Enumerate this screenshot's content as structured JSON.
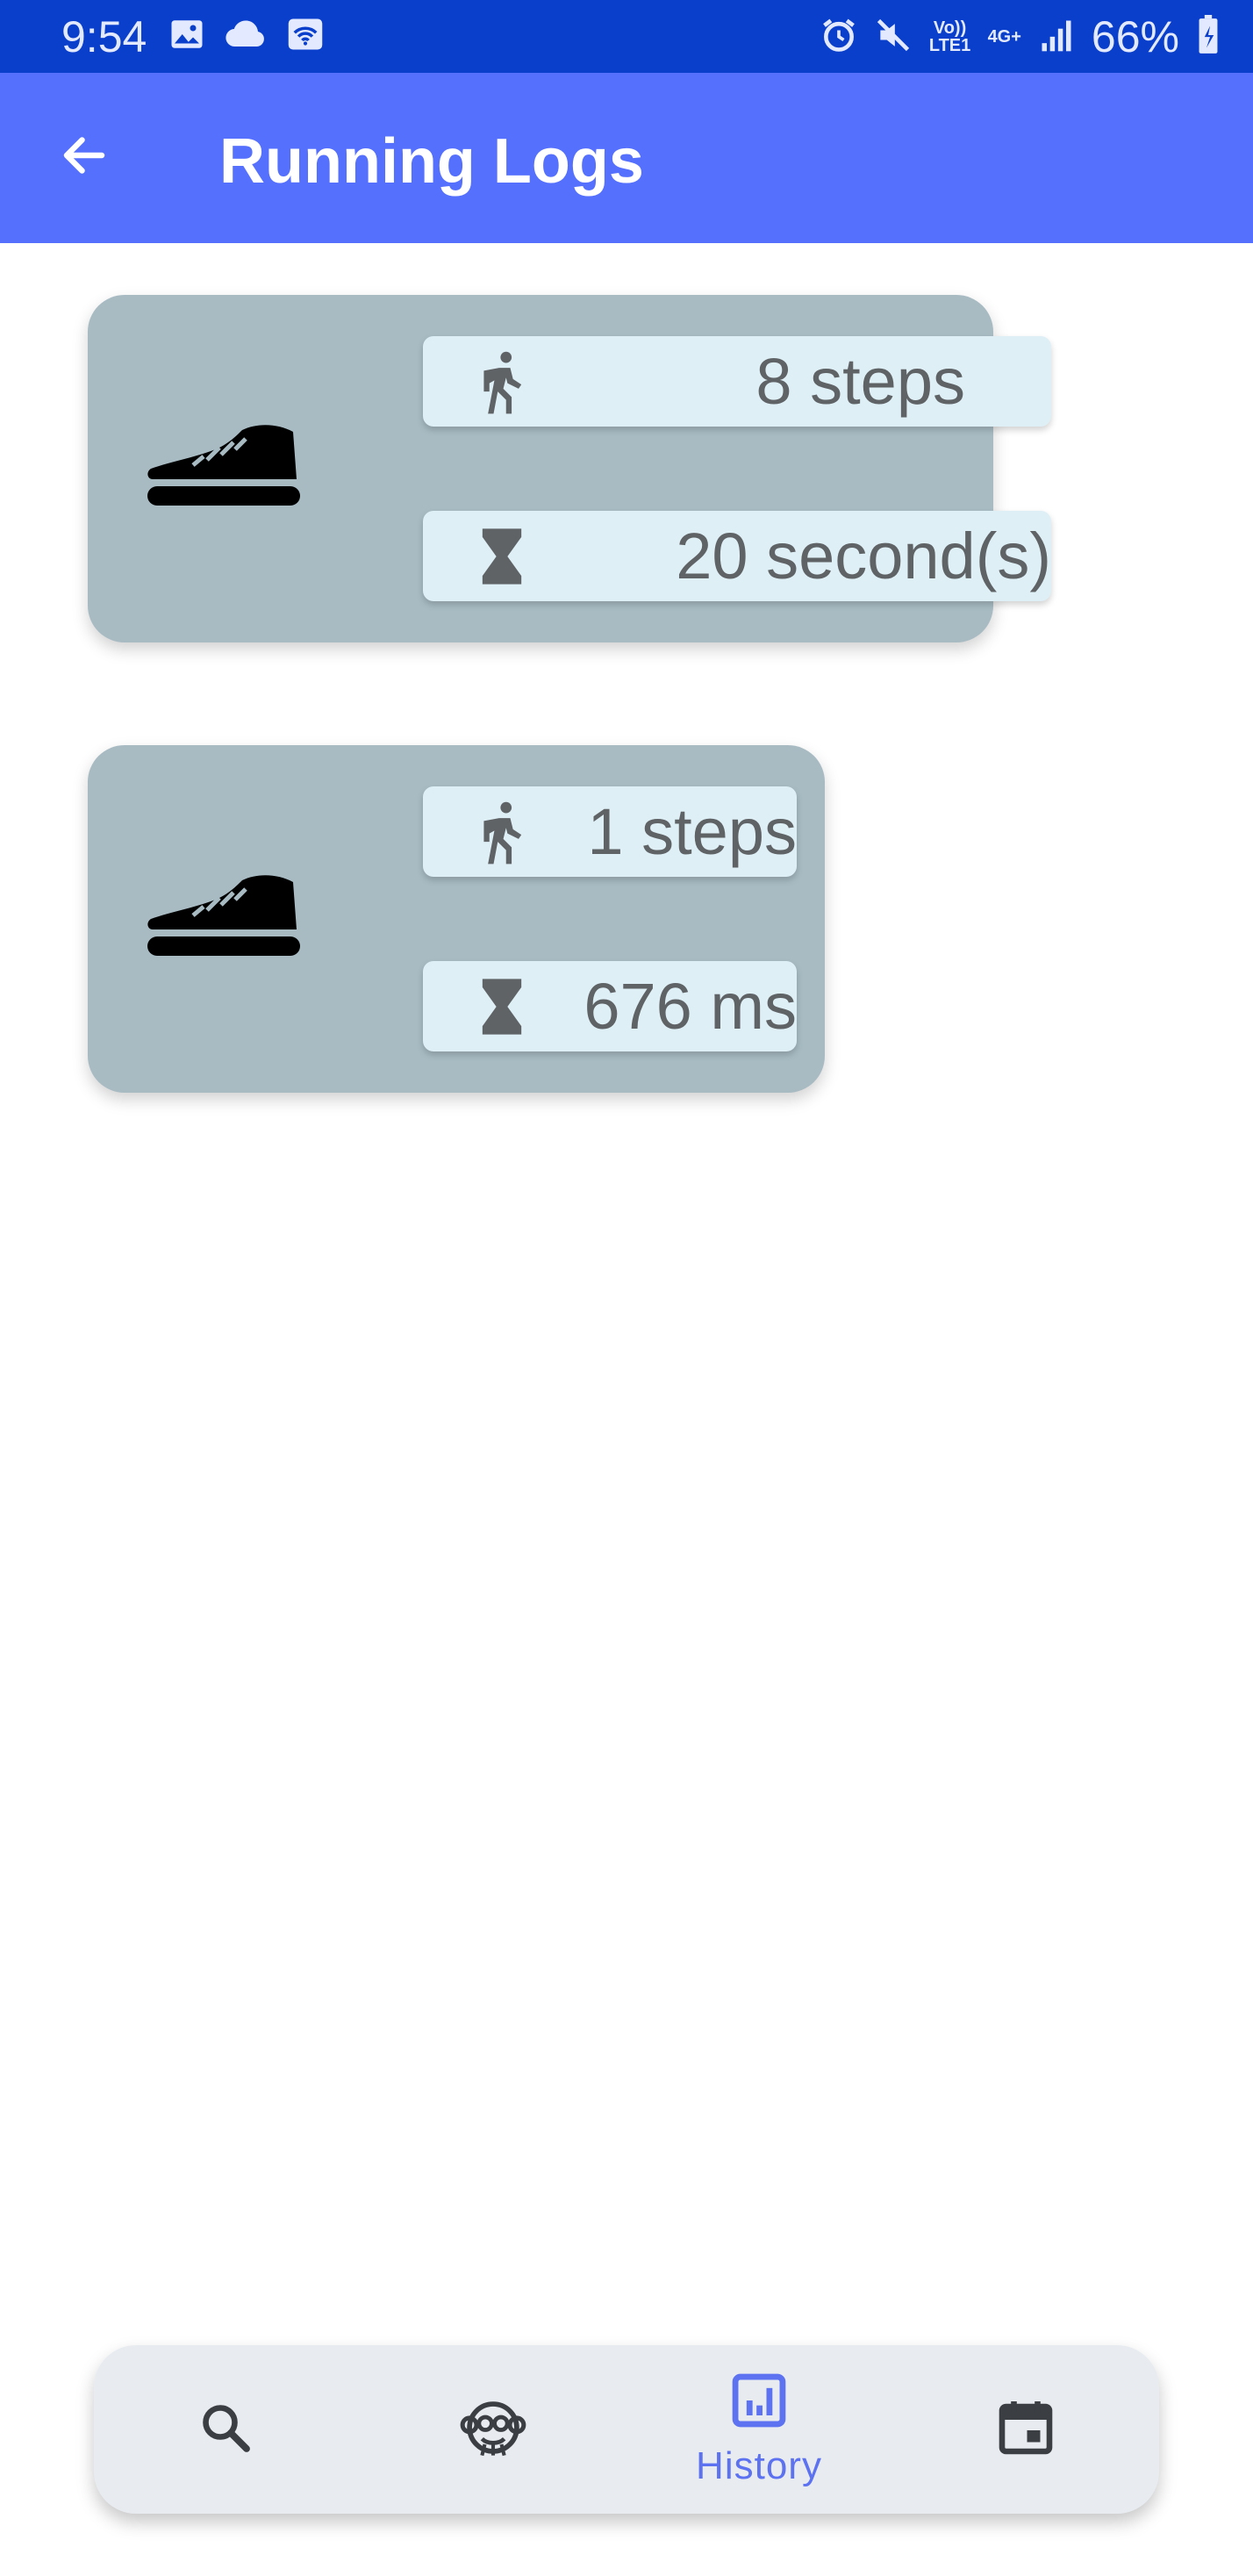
{
  "status_bar": {
    "time": "9:54",
    "battery": "66%",
    "volte_label": "Vo)) LTE1",
    "network_label": "4G+",
    "left_icons": [
      "gallery-icon",
      "cloud-icon",
      "wifi-icon"
    ],
    "right_icons": [
      "alarm-icon",
      "mute-icon",
      "volte-icon",
      "network-icon",
      "signal-icon",
      "battery-icon"
    ]
  },
  "app_bar": {
    "title": "Running Logs",
    "back_icon": "arrow-back-icon",
    "background": "#5570fd"
  },
  "logs": [
    {
      "steps": "8 steps",
      "duration": "20 second(s)"
    },
    {
      "steps": "1 steps",
      "duration": "676 ms"
    }
  ],
  "bottom_nav": {
    "items": [
      {
        "name": "search",
        "icon": "search-icon",
        "label": ""
      },
      {
        "name": "monkey",
        "icon": "monkey-icon",
        "label": ""
      },
      {
        "name": "history",
        "icon": "history-chart-icon",
        "label": "History",
        "selected": true
      },
      {
        "name": "calendar",
        "icon": "calendar-icon",
        "label": ""
      }
    ],
    "accent": "#5d72f0"
  },
  "colors": {
    "status_bar": "#0a3fcb",
    "card": "#a8bbc3",
    "pill": "#deeff6",
    "pill_text": "#5f6366"
  }
}
